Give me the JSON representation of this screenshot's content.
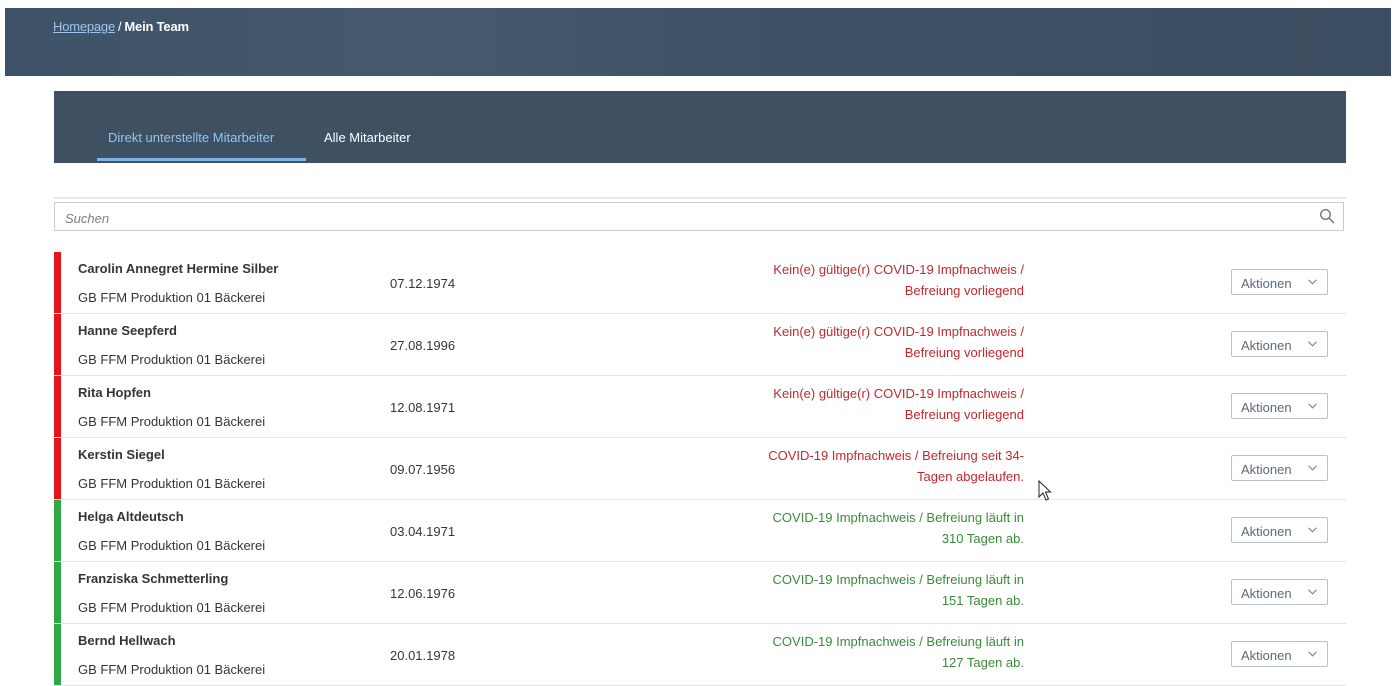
{
  "breadcrumb": {
    "home_label": "Homepage",
    "separator": "/",
    "current": "Mein Team"
  },
  "tabs": {
    "direct_label": "Direkt unterstellte Mitarbeiter",
    "all_label": "Alle Mitarbeiter"
  },
  "search": {
    "placeholder": "Suchen",
    "value": ""
  },
  "colors": {
    "status_red": "#c0292d",
    "status_green": "#3a8a3a",
    "bar_red": "#e3141a",
    "bar_green": "#2fa84a"
  },
  "rows": [
    {
      "name": "Carolin Annegret Hermine Silber",
      "dept": "GB FFM Produktion 01 Bäckerei",
      "dob": "07.12.1974",
      "status_line1": "Kein(e) gültige(r) COVID-19 Impfnachweis /",
      "status_line2": "Befreiung vorliegend",
      "status_kind": "red",
      "action_label": "Aktionen"
    },
    {
      "name": "Hanne Seepferd",
      "dept": "GB FFM Produktion 01 Bäckerei",
      "dob": "27.08.1996",
      "status_line1": "Kein(e) gültige(r) COVID-19 Impfnachweis /",
      "status_line2": "Befreiung vorliegend",
      "status_kind": "red",
      "action_label": "Aktionen"
    },
    {
      "name": "Rita Hopfen",
      "dept": "GB FFM Produktion 01 Bäckerei",
      "dob": "12.08.1971",
      "status_line1": "Kein(e) gültige(r) COVID-19 Impfnachweis /",
      "status_line2": "Befreiung vorliegend",
      "status_kind": "red",
      "action_label": "Aktionen"
    },
    {
      "name": "Kerstin Siegel",
      "dept": "GB FFM Produktion 01 Bäckerei",
      "dob": "09.07.1956",
      "status_line1": "COVID-19 Impfnachweis / Befreiung seit 34-",
      "status_line2": "Tagen abgelaufen.",
      "status_kind": "red",
      "action_label": "Aktionen"
    },
    {
      "name": "Helga Altdeutsch",
      "dept": "GB FFM Produktion 01 Bäckerei",
      "dob": "03.04.1971",
      "status_line1": "COVID-19 Impfnachweis / Befreiung läuft in",
      "status_line2": "310 Tagen ab.",
      "status_kind": "green",
      "action_label": "Aktionen"
    },
    {
      "name": "Franziska Schmetterling",
      "dept": "GB FFM Produktion 01 Bäckerei",
      "dob": "12.06.1976",
      "status_line1": "COVID-19 Impfnachweis / Befreiung läuft in",
      "status_line2": "151 Tagen ab.",
      "status_kind": "green",
      "action_label": "Aktionen"
    },
    {
      "name": "Bernd Hellwach",
      "dept": "GB FFM Produktion 01 Bäckerei",
      "dob": "20.01.1978",
      "status_line1": "COVID-19 Impfnachweis / Befreiung läuft in",
      "status_line2": "127 Tagen ab.",
      "status_kind": "green",
      "action_label": "Aktionen"
    }
  ]
}
